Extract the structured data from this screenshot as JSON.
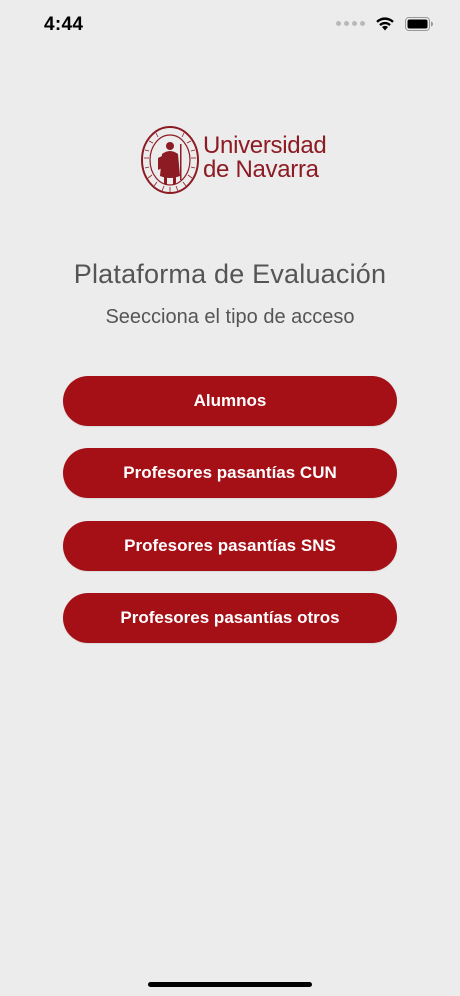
{
  "status_bar": {
    "time": "4:44"
  },
  "logo": {
    "line1": "Universidad",
    "line2": "de Navarra"
  },
  "main": {
    "title": "Plataforma de Evaluación",
    "subtitle": "Seecciona el tipo de acceso",
    "buttons": [
      {
        "label": "Alumnos"
      },
      {
        "label": "Profesores pasantías CUN"
      },
      {
        "label": "Profesores pasantías SNS"
      },
      {
        "label": "Profesores pasantías otros"
      }
    ]
  },
  "colors": {
    "brand": "#a50f16",
    "logo_red": "#8c1b24",
    "background": "#ececec",
    "text_gray": "#555555"
  }
}
